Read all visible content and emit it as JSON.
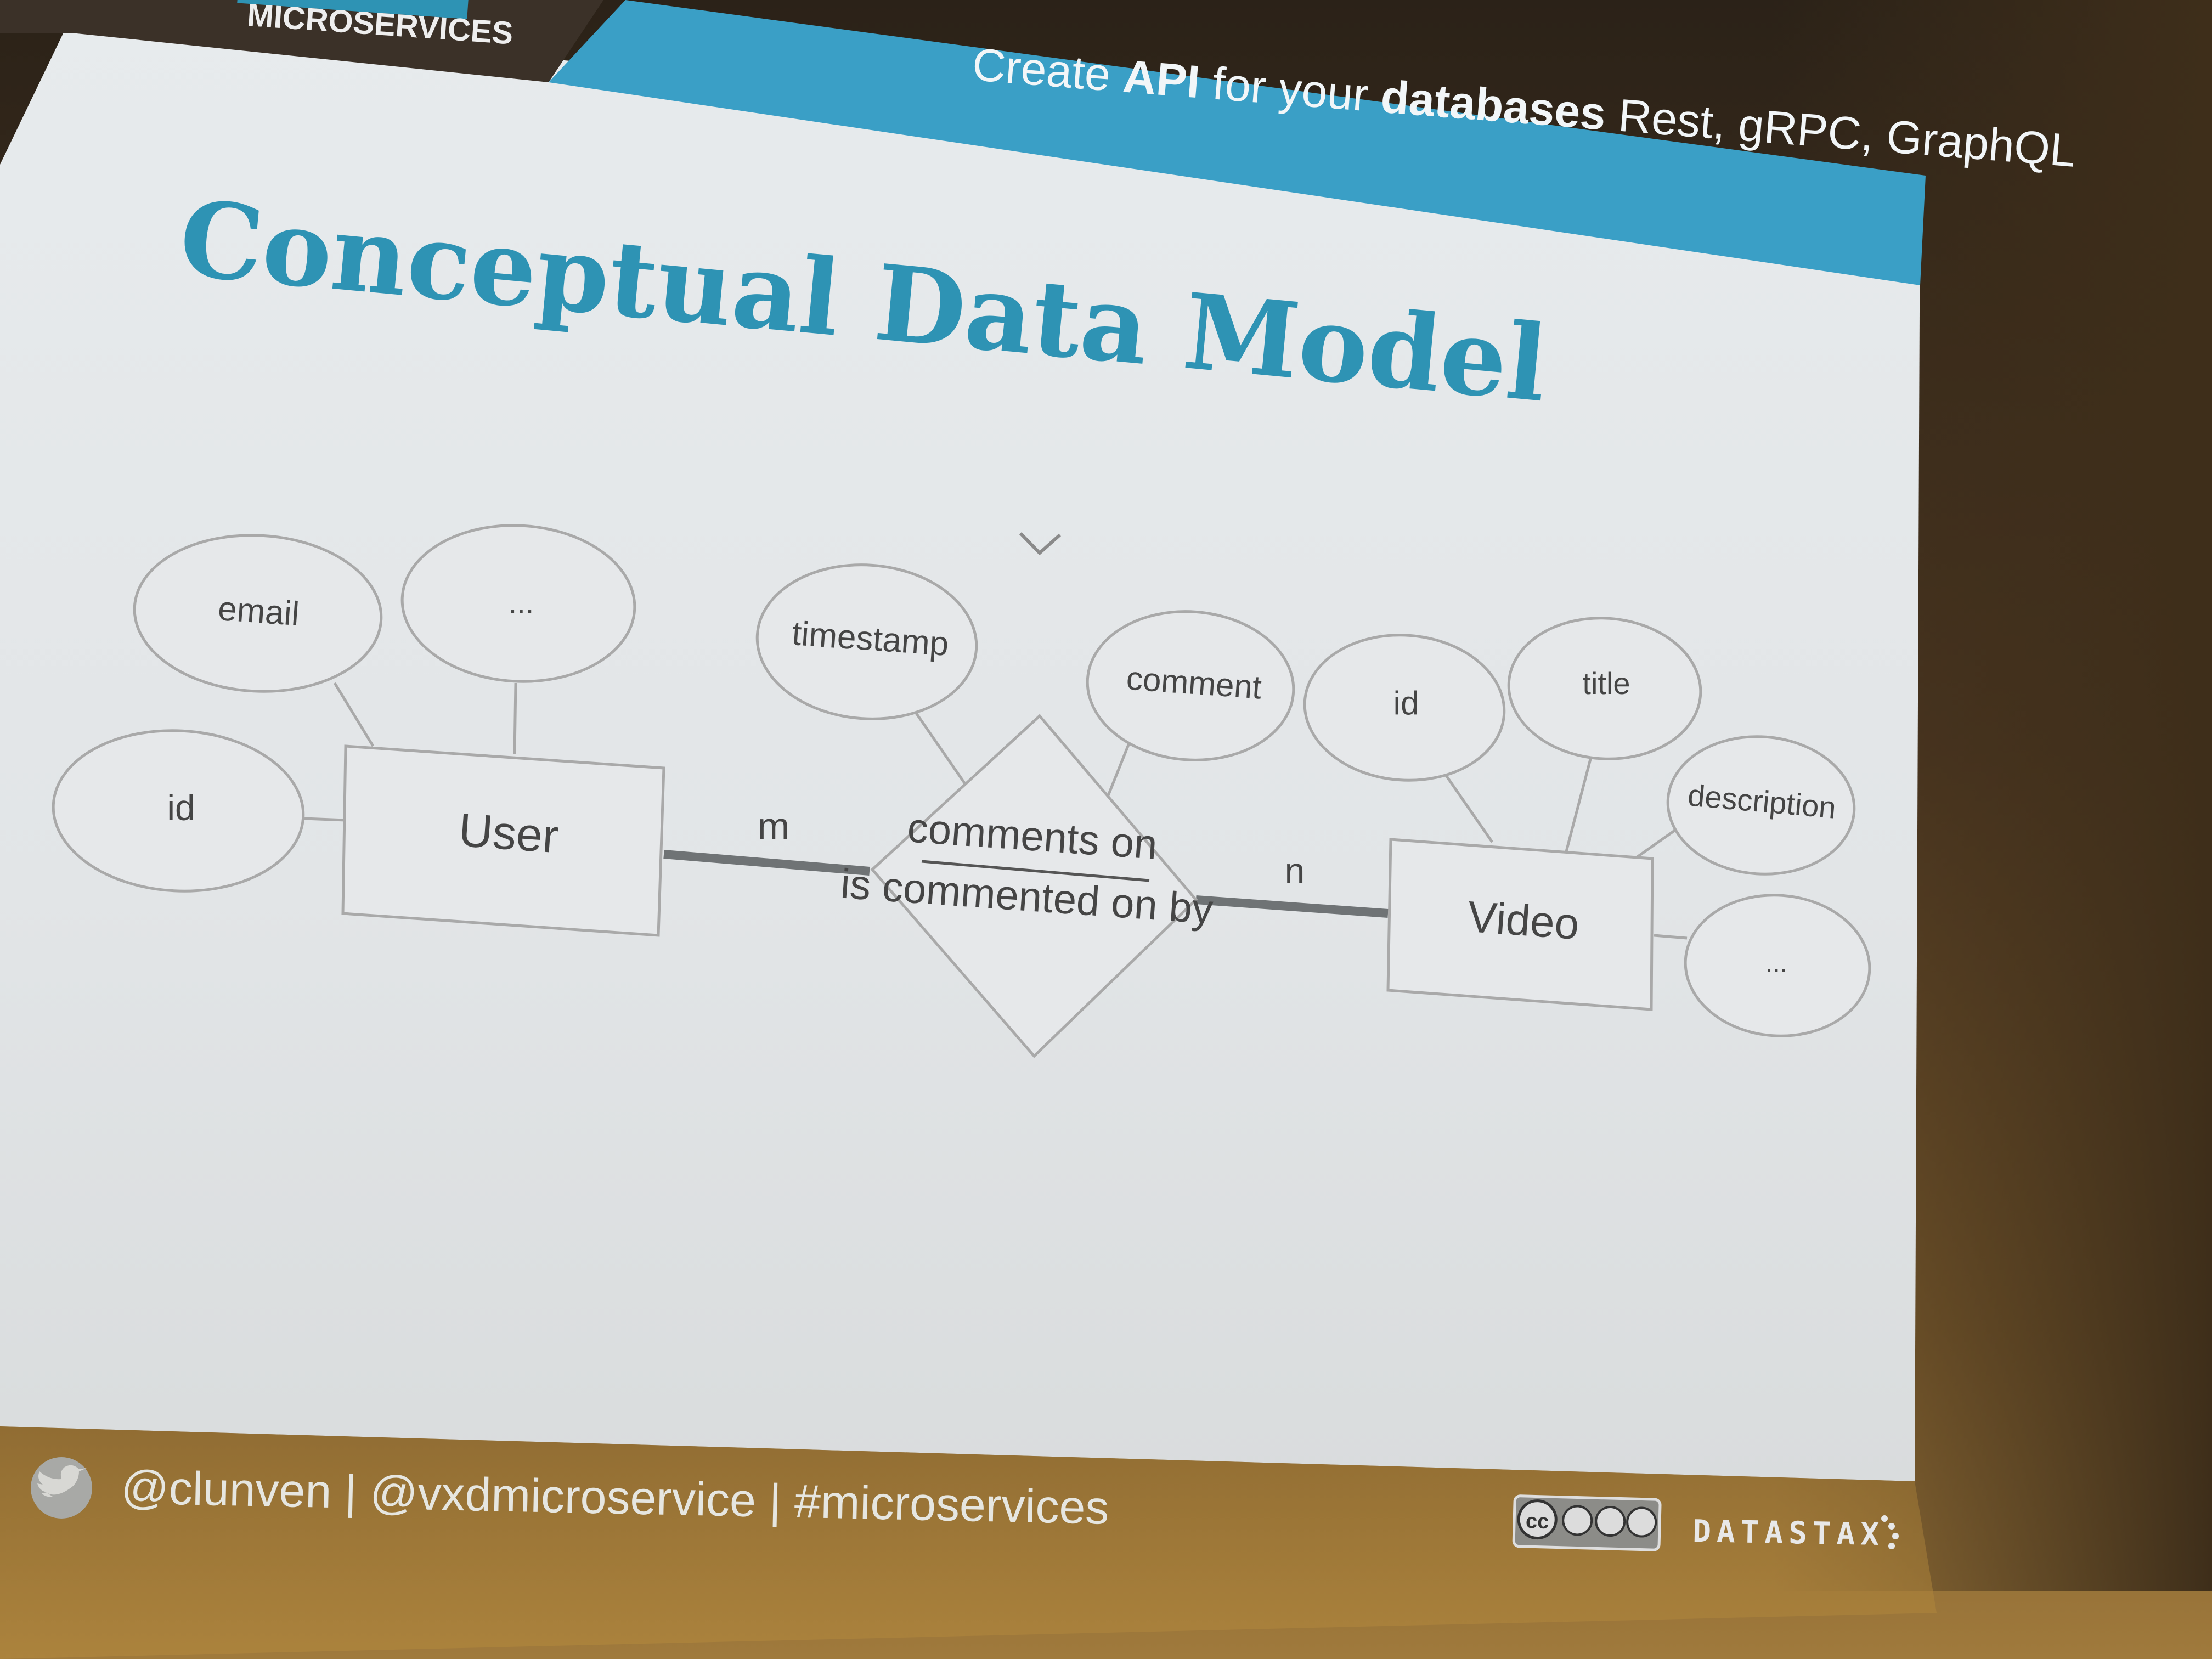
{
  "header": {
    "event_logo": "MICROSERVICES",
    "banner_parts": [
      {
        "text": "Create ",
        "bold": false
      },
      {
        "text": "API",
        "bold": true
      },
      {
        "text": " for your ",
        "bold": false
      },
      {
        "text": "databases",
        "bold": true
      },
      {
        "text": " Rest, gRPC, GraphQL",
        "bold": false
      }
    ]
  },
  "slide": {
    "title": "Conceptual Data Model"
  },
  "diagram": {
    "entities": {
      "user": "User",
      "video": "Video"
    },
    "relationship": {
      "top": "comments on",
      "bottom": "is commented on by"
    },
    "cardinality": {
      "user_side": "m",
      "video_side": "n"
    },
    "user_attributes": {
      "email": "email",
      "more": "...",
      "id": "id"
    },
    "relationship_attributes": {
      "timestamp": "timestamp",
      "comment": "comment"
    },
    "video_attributes": {
      "id": "id",
      "title": "title",
      "description": "description",
      "more": "..."
    }
  },
  "footer": {
    "handles": "@clunven  |  @vxdmicroservice | #microservices",
    "license": "cc",
    "brand": "DATASTAX"
  },
  "colors": {
    "accent": "#2e93b4",
    "banner": "#3a9fc6",
    "slide_background": "#e4e8ea"
  },
  "icons": [
    "twitter-bird-icon",
    "creative-commons-badge-icon",
    "datastax-logo"
  ]
}
